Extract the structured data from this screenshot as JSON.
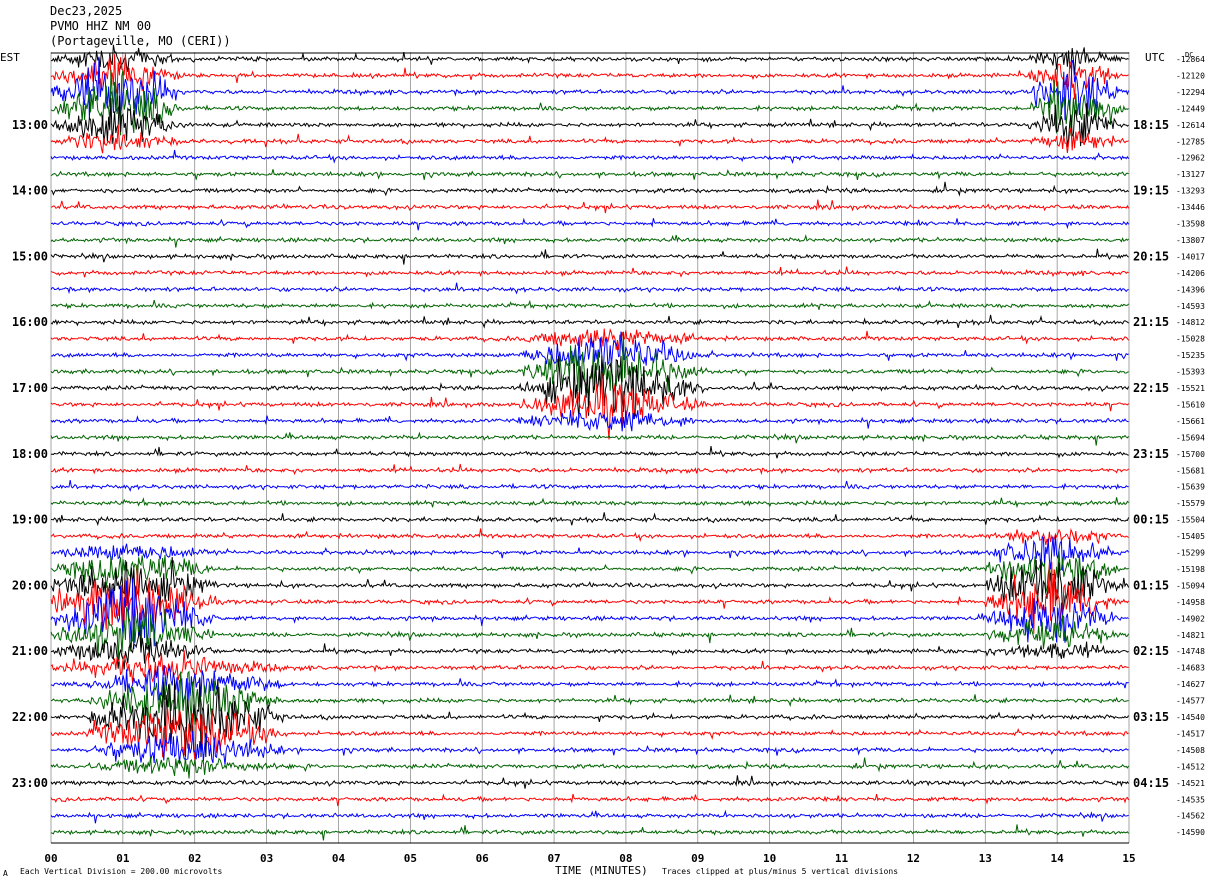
{
  "header": {
    "date": "Dec23,2025",
    "channel": "PVMO HHZ NM 00",
    "station": "(Portageville, MO (CERI))"
  },
  "footer": {
    "scale_note": "Each Vertical Division = 200.00 microvolts",
    "xlabel": "TIME (MINUTES)",
    "clip_note": "Traces clipped at plus/minus 5 vertical divisions",
    "corner_mark": "A"
  },
  "chart_data": {
    "type": "line",
    "title": "Dec23,2025 PVMO HHZ NM 00 (Portageville, MO (CERI))",
    "xlabel": "TIME (MINUTES)",
    "xlim": [
      0,
      15
    ],
    "x_ticks": [
      "00",
      "01",
      "02",
      "03",
      "04",
      "05",
      "06",
      "07",
      "08",
      "09",
      "10",
      "11",
      "12",
      "13",
      "14",
      "15"
    ],
    "left_axis_title": "EST",
    "right_axis_title": "UTC",
    "dc_label": "DC",
    "trace_colors": [
      "#000000",
      "#ff0000",
      "#0000ff",
      "#006400"
    ],
    "est_labels": [
      {
        "row": 4,
        "text": "13:00"
      },
      {
        "row": 8,
        "text": "14:00"
      },
      {
        "row": 12,
        "text": "15:00"
      },
      {
        "row": 16,
        "text": "16:00"
      },
      {
        "row": 20,
        "text": "17:00"
      },
      {
        "row": 24,
        "text": "18:00"
      },
      {
        "row": 28,
        "text": "19:00"
      },
      {
        "row": 32,
        "text": "20:00"
      },
      {
        "row": 36,
        "text": "21:00"
      },
      {
        "row": 40,
        "text": "22:00"
      },
      {
        "row": 44,
        "text": "23:00"
      }
    ],
    "utc_labels": [
      {
        "row": 4,
        "text": "18:15"
      },
      {
        "row": 8,
        "text": "19:15"
      },
      {
        "row": 12,
        "text": "20:15"
      },
      {
        "row": 16,
        "text": "21:15"
      },
      {
        "row": 20,
        "text": "22:15"
      },
      {
        "row": 24,
        "text": "23:15"
      },
      {
        "row": 28,
        "text": "00:15"
      },
      {
        "row": 32,
        "text": "01:15"
      },
      {
        "row": 36,
        "text": "02:15"
      },
      {
        "row": 40,
        "text": "03:15"
      },
      {
        "row": 44,
        "text": "04:15"
      }
    ],
    "dc_offsets": [
      "-12864",
      "-12120",
      "-12294",
      "-12449",
      "-12614",
      "-12785",
      "-12962",
      "-13127",
      "-13293",
      "-13446",
      "-13598",
      "-13807",
      "-14017",
      "-14206",
      "-14396",
      "-14593",
      "-14812",
      "-15028",
      "-15235",
      "-15393",
      "-15521",
      "-15610",
      "-15661",
      "-15694",
      "-15700",
      "-15681",
      "-15639",
      "-15579",
      "-15504",
      "-15405",
      "-15299",
      "-15198",
      "-15094",
      "-14958",
      "-14902",
      "-14821",
      "-14748",
      "-14683",
      "-14627",
      "-14577",
      "-14540",
      "-14517",
      "-14508",
      "-14512",
      "-14521",
      "-14535",
      "-14562",
      "-14590"
    ],
    "events": [
      {
        "rows": [
          0,
          5
        ],
        "x_start": 0.0,
        "x_end": 2.0,
        "amplitude": "clipped",
        "color_row": 1
      },
      {
        "rows": [
          0,
          5
        ],
        "x_start": 13.6,
        "x_end": 15.0,
        "amplitude": "clipped",
        "color_row": 0
      },
      {
        "rows": [
          17,
          22
        ],
        "x_start": 6.5,
        "x_end": 9.3,
        "amplitude": "clipped",
        "color_row": 19
      },
      {
        "rows": [
          30,
          37
        ],
        "x_start": 0.0,
        "x_end": 2.5,
        "amplitude": "clipped",
        "color_row": 33
      },
      {
        "rows": [
          29,
          36
        ],
        "x_start": 13.0,
        "x_end": 15.0,
        "amplitude": "clipped",
        "color_row": 32
      },
      {
        "rows": [
          37,
          43
        ],
        "x_start": 0.5,
        "x_end": 3.5,
        "amplitude": "clipped",
        "color_row": 39
      }
    ]
  }
}
